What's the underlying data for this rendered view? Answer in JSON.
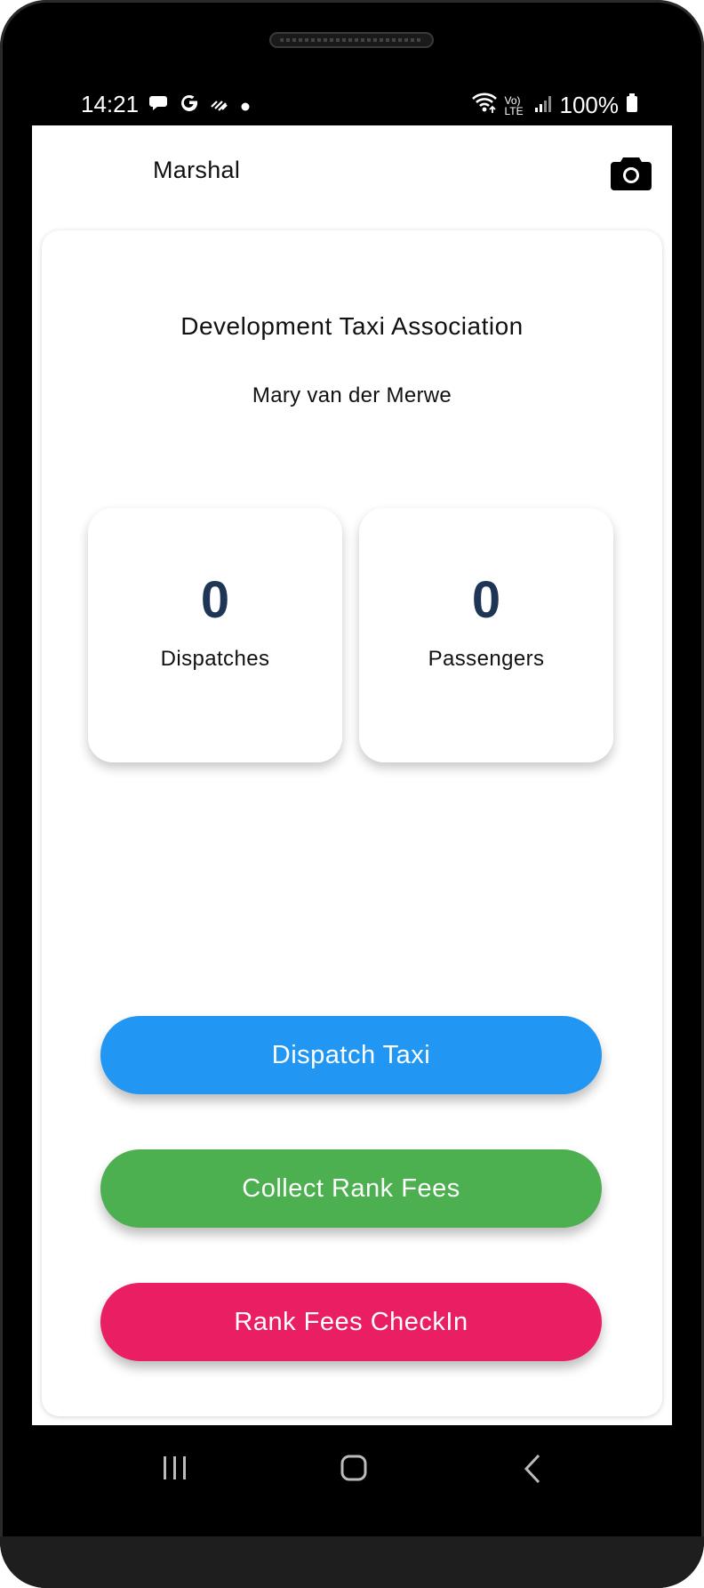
{
  "status_bar": {
    "time": "14:21",
    "network": "Vo) LTE",
    "battery": "100%"
  },
  "app_bar": {
    "title": "Marshal",
    "camera_icon": "camera-icon"
  },
  "card": {
    "association": "Development Taxi Association",
    "user_name": "Mary van der Merwe"
  },
  "stats": [
    {
      "value": "0",
      "label": "Dispatches"
    },
    {
      "value": "0",
      "label": "Passengers"
    }
  ],
  "actions": {
    "dispatch": {
      "label": "Dispatch Taxi",
      "color": "#2196F3"
    },
    "collect": {
      "label": "Collect Rank Fees",
      "color": "#4CAF50"
    },
    "checkin": {
      "label": "Rank Fees CheckIn",
      "color": "#E91E63"
    }
  },
  "colors": {
    "stat_number": "#1E3556"
  }
}
